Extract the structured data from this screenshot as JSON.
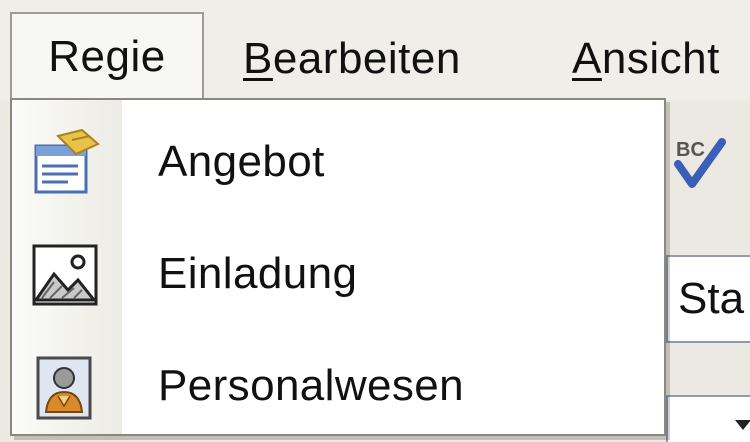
{
  "menubar": {
    "items": [
      {
        "label": "Regie",
        "active": true
      },
      {
        "label": "Bearbeiten",
        "mnemonic": "B"
      },
      {
        "label": "Ansicht",
        "mnemonic": "A"
      }
    ]
  },
  "dropdown": {
    "items": [
      {
        "label": "Angebot",
        "icon": "offer-form-icon"
      },
      {
        "label": "Einladung",
        "icon": "picture-icon"
      },
      {
        "label": "Personalwesen",
        "icon": "person-icon"
      }
    ]
  },
  "toolbar": {
    "spell_icon": "spellcheck-icon",
    "combo_text": "Sta"
  },
  "colors": {
    "menubar_bg": "#efeee8",
    "menu_border": "#8a887f",
    "icon_strip": "#ecebe4"
  }
}
